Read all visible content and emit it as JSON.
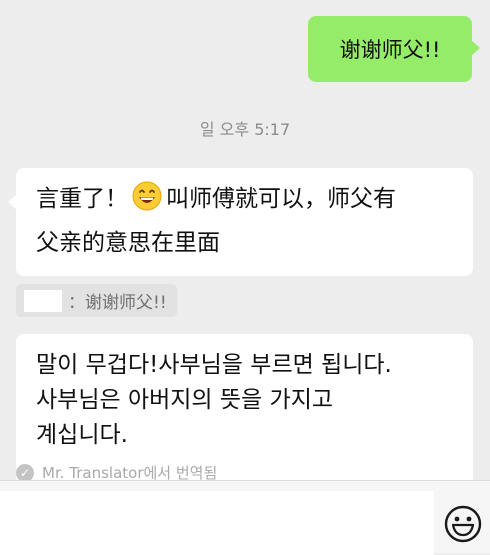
{
  "outgoing": {
    "text": "谢谢师父!!"
  },
  "timestamp": "일 오후 5:17",
  "incoming": {
    "line1_before": "言重了！",
    "emoji": "grinning-face-emoji",
    "line1_after": "叫师傅就可以，师父有",
    "line2": "父亲的意思在里面"
  },
  "quote": {
    "text": "：谢谢师父!!"
  },
  "translation": {
    "line1": "말이 무겁다!사부님을 부르면 됩니다.",
    "line2": "사부님은 아버지의 뜻을 가지고",
    "line3": "계십니다.",
    "note": "Mr. Translator에서 번역됨"
  },
  "input": {
    "placeholder": ""
  },
  "icons": {
    "emoji_button": "smiley-face-icon",
    "check": "check-circle-icon"
  },
  "colors": {
    "outgoing_bubble": "#95ec69",
    "background": "#ededed"
  }
}
